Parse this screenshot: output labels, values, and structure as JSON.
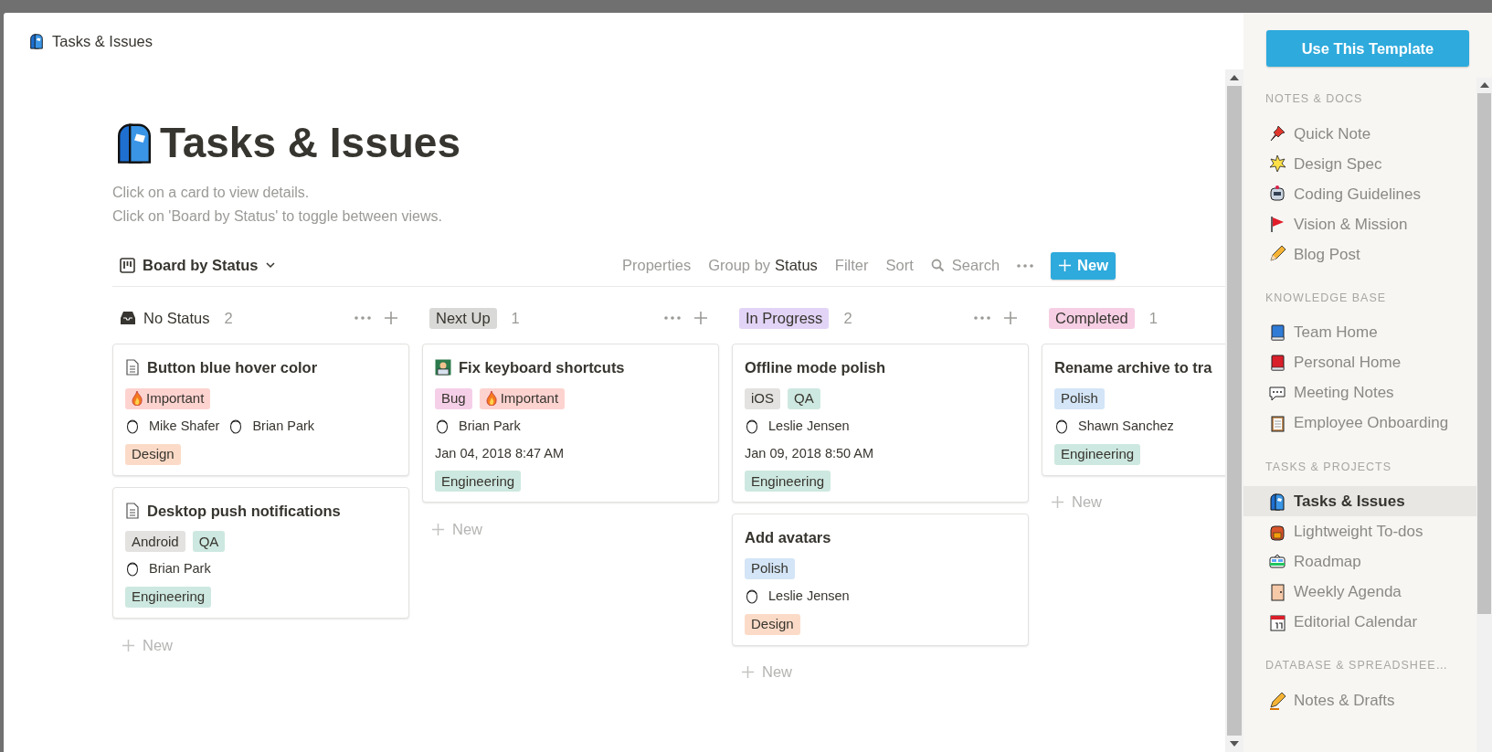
{
  "header": {
    "title": "Tasks & Issues"
  },
  "page": {
    "title": "Tasks & Issues",
    "description": [
      "Click on a card to view details.",
      "Click on 'Board by Status' to toggle between views."
    ]
  },
  "toolbar": {
    "view": "Board by Status",
    "properties": "Properties",
    "group_by": "Group by",
    "group_by_value": "Status",
    "filter": "Filter",
    "sort": "Sort",
    "search": "Search",
    "new": "New"
  },
  "columns": [
    {
      "label": "No Status",
      "count": "2",
      "kind": "plain",
      "new": "New",
      "cards": [
        {
          "title": "Button blue hover color",
          "kind": "page",
          "tags": [
            {
              "label": "Important",
              "color": "#fdd3d0",
              "kind": "fire"
            }
          ],
          "people": [
            "Mike Shafer",
            "Brian Park"
          ],
          "team": {
            "label": "Design",
            "color": "#fbdbc8"
          }
        },
        {
          "title": "Desktop push notifications",
          "kind": "page",
          "tags": [
            {
              "label": "Android",
              "color": "#e3e2e0",
              "kind": "plain"
            },
            {
              "label": "QA",
              "color": "#cde8e0",
              "kind": "plain"
            }
          ],
          "people": [
            "Brian Park"
          ],
          "team": {
            "label": "Engineering",
            "color": "#cde8e0"
          }
        }
      ]
    },
    {
      "label": "Next Up",
      "count": "1",
      "kind": "pill",
      "color": "#d9d9d7",
      "new": "New",
      "cards": [
        {
          "title": "Fix keyboard shortcuts",
          "kind": "emoji",
          "tags": [
            {
              "label": "Bug",
              "color": "#f5cfe8",
              "kind": "plain"
            },
            {
              "label": "Important",
              "color": "#fdd3d0",
              "kind": "fire"
            }
          ],
          "people": [
            "Brian Park"
          ],
          "date": "Jan 04, 2018 8:47 AM",
          "team": {
            "label": "Engineering",
            "color": "#cde8e0"
          }
        }
      ]
    },
    {
      "label": "In Progress",
      "count": "2",
      "kind": "pill",
      "color": "#e2d4f7",
      "new": "New",
      "cards": [
        {
          "title": "Offline mode polish",
          "kind": "plain",
          "tags": [
            {
              "label": "iOS",
              "color": "#e3e2e0",
              "kind": "plain"
            },
            {
              "label": "QA",
              "color": "#cde8e0",
              "kind": "plain"
            }
          ],
          "people": [
            "Leslie Jensen"
          ],
          "date": "Jan 09, 2018 8:50 AM",
          "team": {
            "label": "Engineering",
            "color": "#cde8e0"
          }
        },
        {
          "title": "Add avatars",
          "kind": "plain",
          "tags": [
            {
              "label": "Polish",
              "color": "#d3e5f7",
              "kind": "plain"
            }
          ],
          "people": [
            "Leslie Jensen"
          ],
          "team": {
            "label": "Design",
            "color": "#fbdbc8"
          }
        }
      ]
    },
    {
      "label": "Completed",
      "count": "1",
      "kind": "pill",
      "color": "#f6cfe5",
      "new": "New",
      "cards": [
        {
          "title": "Rename archive to tra",
          "kind": "plain",
          "tags": [
            {
              "label": "Polish",
              "color": "#d3e5f7",
              "kind": "plain"
            }
          ],
          "people": [
            "Shawn Sanchez"
          ],
          "team": {
            "label": "Engineering",
            "color": "#cde8e0"
          }
        }
      ]
    }
  ],
  "sidebar": {
    "button": "Use This Template",
    "sections": [
      {
        "heading": "NOTES & DOCS",
        "items": [
          {
            "label": "Quick Note",
            "selected": false
          },
          {
            "label": "Design Spec",
            "selected": false
          },
          {
            "label": "Coding Guidelines",
            "selected": false
          },
          {
            "label": "Vision & Mission",
            "selected": false
          },
          {
            "label": "Blog Post",
            "selected": false
          }
        ]
      },
      {
        "heading": "KNOWLEDGE BASE",
        "items": [
          {
            "label": "Team Home",
            "selected": false
          },
          {
            "label": "Personal Home",
            "selected": false
          },
          {
            "label": "Meeting Notes",
            "selected": false
          },
          {
            "label": "Employee Onboarding",
            "selected": false
          }
        ]
      },
      {
        "heading": "TASKS & PROJECTS",
        "items": [
          {
            "label": "Tasks & Issues",
            "selected": true
          },
          {
            "label": "Lightweight To-dos",
            "selected": false
          },
          {
            "label": "Roadmap",
            "selected": false
          },
          {
            "label": "Weekly Agenda",
            "selected": false
          },
          {
            "label": "Editorial Calendar",
            "selected": false
          }
        ]
      },
      {
        "heading": "DATABASE & SPREADSHEE…",
        "items": [
          {
            "label": "Notes & Drafts",
            "selected": false
          }
        ]
      }
    ]
  }
}
